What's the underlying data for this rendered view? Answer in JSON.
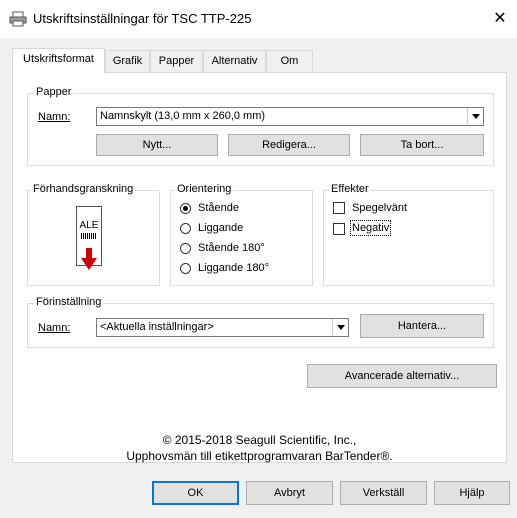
{
  "window": {
    "title": "Utskriftsinställningar för TSC TTP-225",
    "close_glyph": "✕"
  },
  "tabs": [
    {
      "label": "Utskriftsformat"
    },
    {
      "label": "Grafik"
    },
    {
      "label": "Papper"
    },
    {
      "label": "Alternativ"
    },
    {
      "label": "Om"
    }
  ],
  "paper": {
    "legend": "Papper",
    "name_label": "Namn:",
    "name_value": "Namnskylt (13,0 mm x 260,0 mm)",
    "new_button": "Nytt...",
    "edit_button": "Redigera...",
    "delete_button": "Ta bort..."
  },
  "preview": {
    "legend": "Förhandsgranskning",
    "label_text": "ALE"
  },
  "orientation": {
    "legend": "Orientering",
    "options": [
      {
        "label": "Stående",
        "selected": true
      },
      {
        "label": "Liggande",
        "selected": false
      },
      {
        "label": "Stående 180°",
        "selected": false
      },
      {
        "label": "Liggande 180°",
        "selected": false
      }
    ]
  },
  "effects": {
    "legend": "Effekter",
    "options": [
      {
        "label": "Spegelvänt",
        "checked": false
      },
      {
        "label": "Negativ",
        "checked": false
      }
    ]
  },
  "preset": {
    "legend": "Förinställning",
    "name_label": "Namn:",
    "name_value": "<Aktuella inställningar>",
    "manage_button": "Hantera..."
  },
  "advanced_button": "Avancerade alternativ...",
  "copyright": {
    "line1": "© 2015-2018 Seagull Scientific, Inc.,",
    "line2": "Upphovsmän till etikettprogramvaran BarTender®."
  },
  "footer": {
    "ok": "OK",
    "cancel": "Avbryt",
    "apply": "Verkställ",
    "help": "Hjälp"
  },
  "colors": {
    "accent": "#0078d7",
    "arrow": "#d00000"
  }
}
